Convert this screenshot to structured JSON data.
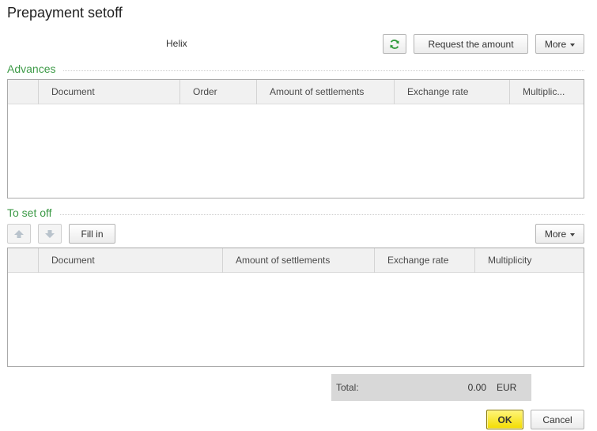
{
  "header": {
    "title": "Prepayment setoff",
    "counterparty": "Helix"
  },
  "toolbar": {
    "refresh_icon": "refresh-icon",
    "request_label": "Request the amount",
    "more_label": "More"
  },
  "advances": {
    "title": "Advances",
    "columns": [
      "Document",
      "Order",
      "Amount of settlements",
      "Exchange rate",
      "Multiplic..."
    ],
    "rows": []
  },
  "setoff": {
    "title": "To set off",
    "move_up_icon": "arrow-up-icon",
    "move_down_icon": "arrow-down-icon",
    "fill_label": "Fill in",
    "more_label": "More",
    "columns": [
      "Document",
      "Amount of settlements",
      "Exchange rate",
      "Multiplicity"
    ],
    "rows": []
  },
  "totals": {
    "label": "Total:",
    "value": "0.00",
    "currency": "EUR"
  },
  "footer": {
    "ok_label": "OK",
    "cancel_label": "Cancel"
  },
  "colors": {
    "section_title": "#3c9a46",
    "ok_button": "#f3dc00",
    "refresh_icon": "#2f9a3a"
  }
}
